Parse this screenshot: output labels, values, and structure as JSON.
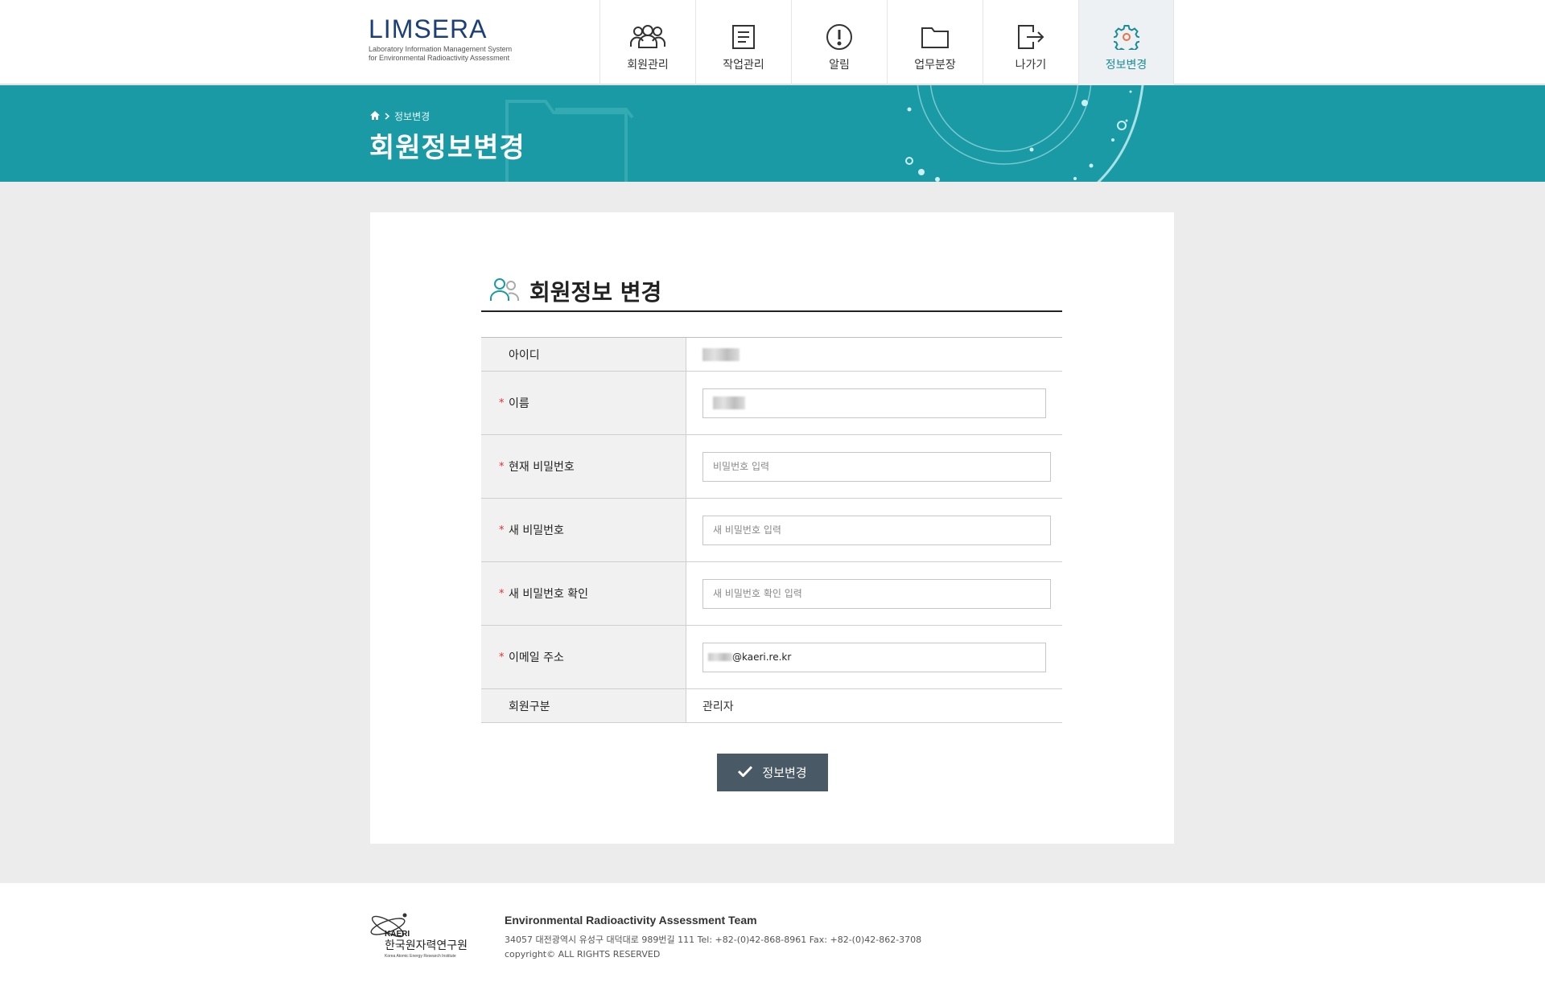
{
  "header": {
    "logo_title": "LIMSERA",
    "logo_sub_1": "Laboratory Information Management System",
    "logo_sub_2": "for Environmental Radioactivity Assessment",
    "nav": [
      {
        "label": "회원관리",
        "icon": "users-icon"
      },
      {
        "label": "작업관리",
        "icon": "document-icon"
      },
      {
        "label": "알림",
        "icon": "alert-icon"
      },
      {
        "label": "업무분장",
        "icon": "folder-icon"
      },
      {
        "label": "나가기",
        "icon": "logout-icon"
      },
      {
        "label": "정보변경",
        "icon": "gear-icon",
        "active": true
      }
    ]
  },
  "banner": {
    "breadcrumb_current": "정보변경",
    "title": "회원정보변경"
  },
  "form": {
    "section_title": "회원정보 변경",
    "fields": {
      "id": {
        "label": "아이디"
      },
      "name": {
        "label": "이름"
      },
      "current_pw": {
        "label": "현재 비밀번호",
        "placeholder": "비밀번호 입력"
      },
      "new_pw": {
        "label": "새 비밀번호",
        "placeholder": "새 비밀번호 입력"
      },
      "new_pw_confirm": {
        "label": "새 비밀번호 확인",
        "placeholder": "새 비밀번호 확인 입력"
      },
      "email": {
        "label": "이메일 주소",
        "domain_value": "@kaeri.re.kr"
      },
      "member_type": {
        "label": "회원구분",
        "value": "관리자"
      }
    },
    "required_mark": "*",
    "submit_label": "정보변경"
  },
  "footer": {
    "logo_en": "KAERI",
    "logo_kr": "한국원자력연구원",
    "logo_sub": "Korea Atomic Energy Research Institute",
    "team": "Environmental Radioactivity Assessment Team",
    "address": "34057 대전광역시 유성구 대덕대로 989번길 111 Tel: +82-(0)42-868-8961 Fax: +82-(0)42-862-3708",
    "copyright": "copyright© ALL RIGHTS RESERVED"
  },
  "colors": {
    "accent": "#1a9aa4",
    "navy": "#1c3f7a",
    "button": "#4a5966",
    "required": "#e03030"
  }
}
